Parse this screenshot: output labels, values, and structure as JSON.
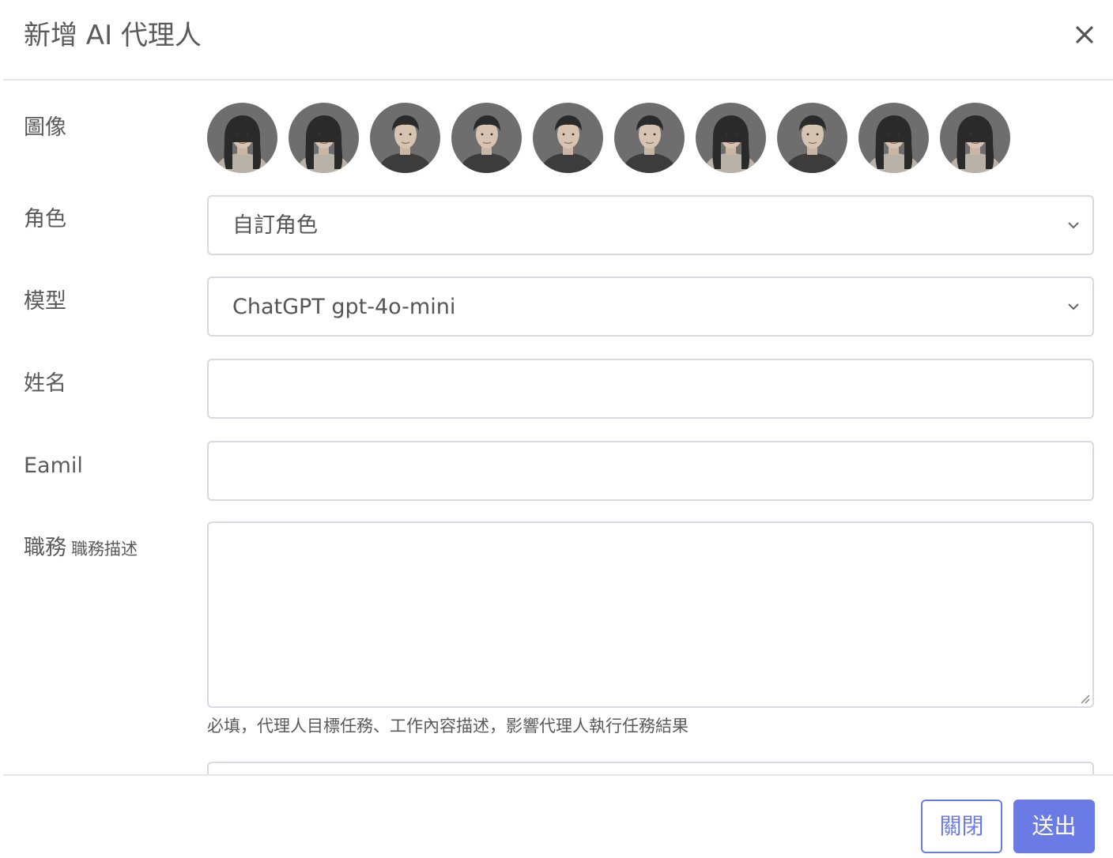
{
  "modal": {
    "title": "新增 AI 代理人",
    "close_icon": "close-icon"
  },
  "form": {
    "avatar_label": "圖像",
    "avatars": [
      {
        "name": "avatar-1",
        "tone": "female"
      },
      {
        "name": "avatar-2",
        "tone": "female"
      },
      {
        "name": "avatar-3",
        "tone": "male"
      },
      {
        "name": "avatar-4",
        "tone": "male"
      },
      {
        "name": "avatar-5",
        "tone": "male"
      },
      {
        "name": "avatar-6",
        "tone": "male"
      },
      {
        "name": "avatar-7",
        "tone": "female"
      },
      {
        "name": "avatar-8",
        "tone": "male"
      },
      {
        "name": "avatar-9",
        "tone": "female"
      },
      {
        "name": "avatar-10",
        "tone": "female"
      }
    ],
    "role_label": "角色",
    "role_value": "自訂角色",
    "model_label": "模型",
    "model_value": "ChatGPT gpt-4o-mini",
    "name_label": "姓名",
    "name_value": "",
    "email_label": "Eamil",
    "email_value": "",
    "job_label": "職務",
    "job_sublabel": "職務描述",
    "job_value": "",
    "job_hint": "必填，代理人目標任務、工作內容描述，影響代理人執行任務結果"
  },
  "footer": {
    "close_label": "關閉",
    "submit_label": "送出"
  },
  "colors": {
    "accent": "#6b7be6",
    "border": "#d8d8e6",
    "text": "#5a5a5a"
  }
}
